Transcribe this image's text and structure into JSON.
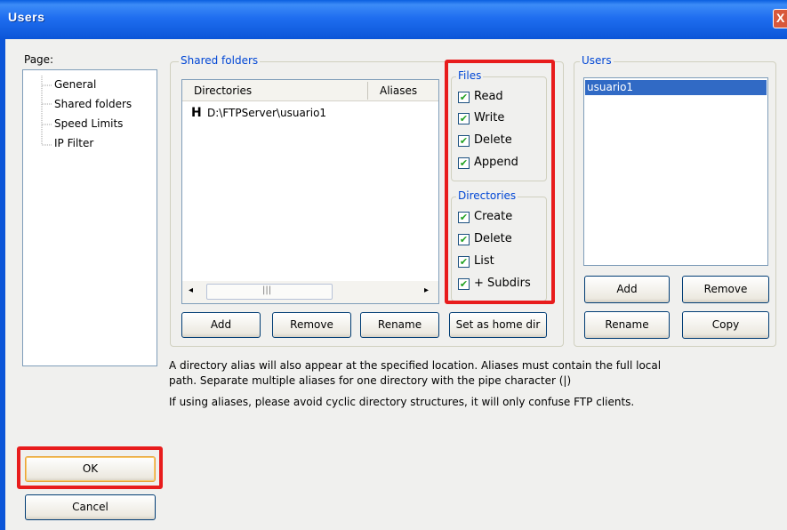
{
  "window": {
    "title": "Users",
    "close_glyph": "X"
  },
  "page_tree": {
    "label": "Page:",
    "items": [
      "General",
      "Shared folders",
      "Speed Limits",
      "IP Filter"
    ]
  },
  "shared_folders": {
    "group_title": "Shared folders",
    "columns": [
      "Directories",
      "Aliases"
    ],
    "rows": [
      {
        "home_marker": "H",
        "directory": "D:\\FTPServer\\usuario1",
        "alias": ""
      }
    ],
    "buttons": {
      "add": "Add",
      "remove": "Remove",
      "rename": "Rename",
      "set_home": "Set as home dir"
    }
  },
  "files": {
    "group_title": "Files",
    "items": [
      {
        "label": "Read",
        "checked": true
      },
      {
        "label": "Write",
        "checked": true
      },
      {
        "label": "Delete",
        "checked": true
      },
      {
        "label": "Append",
        "checked": true
      }
    ]
  },
  "directories": {
    "group_title": "Directories",
    "items": [
      {
        "label": "Create",
        "checked": true
      },
      {
        "label": "Delete",
        "checked": true
      },
      {
        "label": "List",
        "checked": true
      },
      {
        "label": "+ Subdirs",
        "checked": true
      }
    ]
  },
  "users": {
    "group_title": "Users",
    "list": [
      "usuario1"
    ],
    "buttons": {
      "add": "Add",
      "remove": "Remove",
      "rename": "Rename",
      "copy": "Copy"
    }
  },
  "info_text": {
    "line1": "A directory alias will also appear at the specified location. Aliases must contain the full local",
    "line2": "path. Separate multiple aliases for one directory with the pipe character (|)",
    "line3": "If using aliases, please avoid cyclic directory structures, it will only confuse FTP clients."
  },
  "dialog_buttons": {
    "ok": "OK",
    "cancel": "Cancel"
  },
  "colors": {
    "highlight": "#e81c1c",
    "selection": "#316ac5",
    "title_bar": "#0b55d8"
  }
}
